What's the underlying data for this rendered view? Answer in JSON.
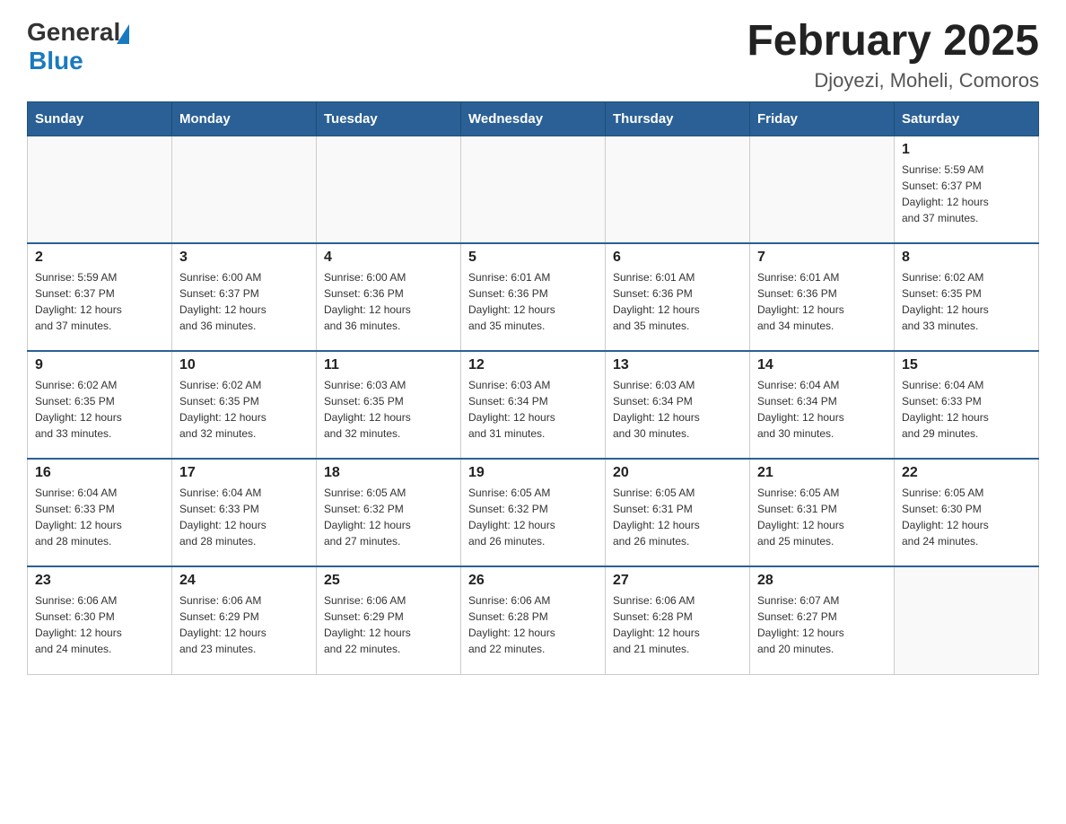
{
  "header": {
    "logo": {
      "text_general": "General",
      "text_blue": "Blue",
      "triangle_aria": "GeneralBlue logo triangle"
    },
    "title": "February 2025",
    "location": "Djoyezi, Moheli, Comoros"
  },
  "days_of_week": [
    "Sunday",
    "Monday",
    "Tuesday",
    "Wednesday",
    "Thursday",
    "Friday",
    "Saturday"
  ],
  "weeks": [
    {
      "days": [
        {
          "num": "",
          "info": ""
        },
        {
          "num": "",
          "info": ""
        },
        {
          "num": "",
          "info": ""
        },
        {
          "num": "",
          "info": ""
        },
        {
          "num": "",
          "info": ""
        },
        {
          "num": "",
          "info": ""
        },
        {
          "num": "1",
          "info": "Sunrise: 5:59 AM\nSunset: 6:37 PM\nDaylight: 12 hours\nand 37 minutes."
        }
      ]
    },
    {
      "days": [
        {
          "num": "2",
          "info": "Sunrise: 5:59 AM\nSunset: 6:37 PM\nDaylight: 12 hours\nand 37 minutes."
        },
        {
          "num": "3",
          "info": "Sunrise: 6:00 AM\nSunset: 6:37 PM\nDaylight: 12 hours\nand 36 minutes."
        },
        {
          "num": "4",
          "info": "Sunrise: 6:00 AM\nSunset: 6:36 PM\nDaylight: 12 hours\nand 36 minutes."
        },
        {
          "num": "5",
          "info": "Sunrise: 6:01 AM\nSunset: 6:36 PM\nDaylight: 12 hours\nand 35 minutes."
        },
        {
          "num": "6",
          "info": "Sunrise: 6:01 AM\nSunset: 6:36 PM\nDaylight: 12 hours\nand 35 minutes."
        },
        {
          "num": "7",
          "info": "Sunrise: 6:01 AM\nSunset: 6:36 PM\nDaylight: 12 hours\nand 34 minutes."
        },
        {
          "num": "8",
          "info": "Sunrise: 6:02 AM\nSunset: 6:35 PM\nDaylight: 12 hours\nand 33 minutes."
        }
      ]
    },
    {
      "days": [
        {
          "num": "9",
          "info": "Sunrise: 6:02 AM\nSunset: 6:35 PM\nDaylight: 12 hours\nand 33 minutes."
        },
        {
          "num": "10",
          "info": "Sunrise: 6:02 AM\nSunset: 6:35 PM\nDaylight: 12 hours\nand 32 minutes."
        },
        {
          "num": "11",
          "info": "Sunrise: 6:03 AM\nSunset: 6:35 PM\nDaylight: 12 hours\nand 32 minutes."
        },
        {
          "num": "12",
          "info": "Sunrise: 6:03 AM\nSunset: 6:34 PM\nDaylight: 12 hours\nand 31 minutes."
        },
        {
          "num": "13",
          "info": "Sunrise: 6:03 AM\nSunset: 6:34 PM\nDaylight: 12 hours\nand 30 minutes."
        },
        {
          "num": "14",
          "info": "Sunrise: 6:04 AM\nSunset: 6:34 PM\nDaylight: 12 hours\nand 30 minutes."
        },
        {
          "num": "15",
          "info": "Sunrise: 6:04 AM\nSunset: 6:33 PM\nDaylight: 12 hours\nand 29 minutes."
        }
      ]
    },
    {
      "days": [
        {
          "num": "16",
          "info": "Sunrise: 6:04 AM\nSunset: 6:33 PM\nDaylight: 12 hours\nand 28 minutes."
        },
        {
          "num": "17",
          "info": "Sunrise: 6:04 AM\nSunset: 6:33 PM\nDaylight: 12 hours\nand 28 minutes."
        },
        {
          "num": "18",
          "info": "Sunrise: 6:05 AM\nSunset: 6:32 PM\nDaylight: 12 hours\nand 27 minutes."
        },
        {
          "num": "19",
          "info": "Sunrise: 6:05 AM\nSunset: 6:32 PM\nDaylight: 12 hours\nand 26 minutes."
        },
        {
          "num": "20",
          "info": "Sunrise: 6:05 AM\nSunset: 6:31 PM\nDaylight: 12 hours\nand 26 minutes."
        },
        {
          "num": "21",
          "info": "Sunrise: 6:05 AM\nSunset: 6:31 PM\nDaylight: 12 hours\nand 25 minutes."
        },
        {
          "num": "22",
          "info": "Sunrise: 6:05 AM\nSunset: 6:30 PM\nDaylight: 12 hours\nand 24 minutes."
        }
      ]
    },
    {
      "days": [
        {
          "num": "23",
          "info": "Sunrise: 6:06 AM\nSunset: 6:30 PM\nDaylight: 12 hours\nand 24 minutes."
        },
        {
          "num": "24",
          "info": "Sunrise: 6:06 AM\nSunset: 6:29 PM\nDaylight: 12 hours\nand 23 minutes."
        },
        {
          "num": "25",
          "info": "Sunrise: 6:06 AM\nSunset: 6:29 PM\nDaylight: 12 hours\nand 22 minutes."
        },
        {
          "num": "26",
          "info": "Sunrise: 6:06 AM\nSunset: 6:28 PM\nDaylight: 12 hours\nand 22 minutes."
        },
        {
          "num": "27",
          "info": "Sunrise: 6:06 AM\nSunset: 6:28 PM\nDaylight: 12 hours\nand 21 minutes."
        },
        {
          "num": "28",
          "info": "Sunrise: 6:07 AM\nSunset: 6:27 PM\nDaylight: 12 hours\nand 20 minutes."
        },
        {
          "num": "",
          "info": ""
        }
      ]
    }
  ]
}
